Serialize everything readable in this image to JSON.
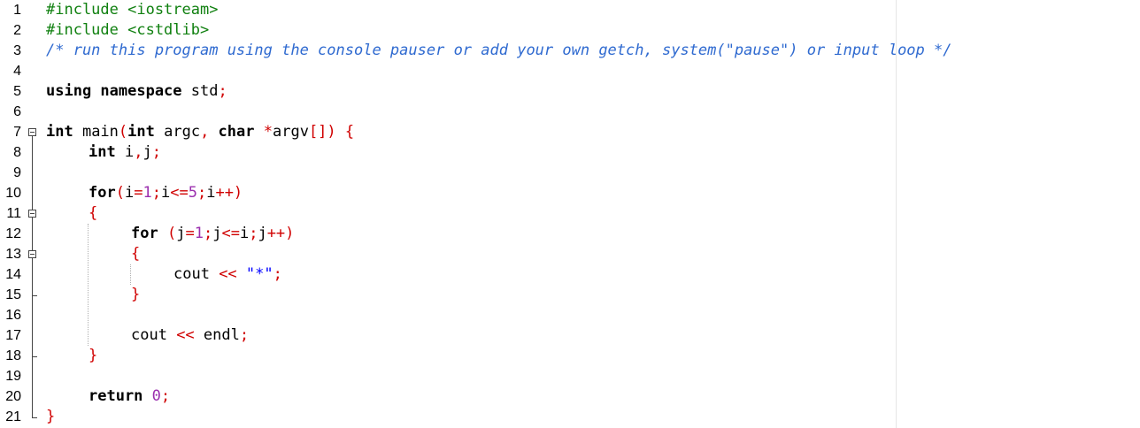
{
  "editor": {
    "line_numbers": [
      "1",
      "2",
      "3",
      "4",
      "5",
      "6",
      "7",
      "8",
      "9",
      "10",
      "11",
      "12",
      "13",
      "14",
      "15",
      "16",
      "17",
      "18",
      "19",
      "20",
      "21"
    ],
    "code": {
      "l1": "#include <iostream>",
      "l2": "#include <cstdlib>",
      "l3": "/* run this program using the console pauser or add your own getch, system(\"pause\") or input loop */",
      "l5_kw": "using namespace",
      "l5_id": " std",
      "l5_op": ";",
      "l7_kw1": "int",
      "l7_id1": " main",
      "l7_op1": "(",
      "l7_kw2": "int",
      "l7_id2": " argc",
      "l7_op2": ", ",
      "l7_kw3": "char",
      "l7_op3": " *",
      "l7_id3": "argv",
      "l7_op4": "[]) {",
      "l8_kw": "int",
      "l8_id": " i",
      "l8_op1": ",",
      "l8_id2": "j",
      "l8_op2": ";",
      "l10_kw": "for",
      "l10_op1": "(",
      "l10_id1": "i",
      "l10_op2": "=",
      "l10_num1": "1",
      "l10_op3": ";",
      "l10_id2": "i",
      "l10_op4": "<=",
      "l10_num2": "5",
      "l10_op5": ";",
      "l10_id3": "i",
      "l10_op6": "++)",
      "l11_op": "{",
      "l12_kw": "for",
      "l12_op1": " (",
      "l12_id1": "j",
      "l12_op2": "=",
      "l12_num1": "1",
      "l12_op3": ";",
      "l12_id2": "j",
      "l12_op4": "<=",
      "l12_id3": "i",
      "l12_op5": ";",
      "l12_id4": "j",
      "l12_op6": "++)",
      "l13_op": "{",
      "l14_id": "cout ",
      "l14_op1": "<<",
      "l14_str": " \"*\"",
      "l14_op2": ";",
      "l15_op": "}",
      "l17_id1": "cout ",
      "l17_op1": "<<",
      "l17_id2": " endl",
      "l17_op2": ";",
      "l18_op": "}",
      "l20_kw": "return",
      "l20_num": " 0",
      "l20_op": ";",
      "l21_op": "}"
    }
  },
  "colors": {
    "preprocessor": "#108010",
    "comment": "#2f6ad0",
    "operator": "#d00000",
    "number": "#9b2fae",
    "string": "#0000ff"
  },
  "icons": {
    "fold": "fold-minus-icon"
  }
}
